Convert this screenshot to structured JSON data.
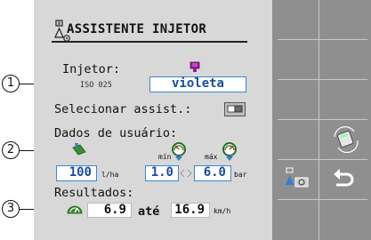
{
  "title": "ASSISTENTE INJETOR",
  "injector": {
    "label": "Injetor:",
    "standard": "ISO 025",
    "value": "violeta",
    "color_hex": "#9a1b9a"
  },
  "select_assist": {
    "label": "Selecionar assist.:"
  },
  "user_data": {
    "label": "Dados de usuário:",
    "rate_value": "100",
    "rate_unit": "l/ha",
    "min_label": "mín",
    "max_label": "máx",
    "pressure_min": "1.0",
    "pressure_max": "6.0",
    "pressure_unit": "bar"
  },
  "results": {
    "label": "Resultados:",
    "speed_from": "6.9",
    "to_word": "até",
    "speed_to": "16.9",
    "speed_unit": "km/h"
  },
  "callouts": [
    "1",
    "2",
    "3"
  ],
  "colors": {
    "panel_bg": "#d8d8d8",
    "softkey_bg": "#8f8f8f",
    "field_border": "#3a87d1",
    "accent_blue": "#2f7fd6",
    "accent_green": "#3a8f2a"
  },
  "softkeys": [
    {
      "icon": "injector-settings-icon"
    },
    {
      "icon": "return-arrow-icon"
    },
    {
      "icon": "calculator-cycle-icon"
    }
  ]
}
